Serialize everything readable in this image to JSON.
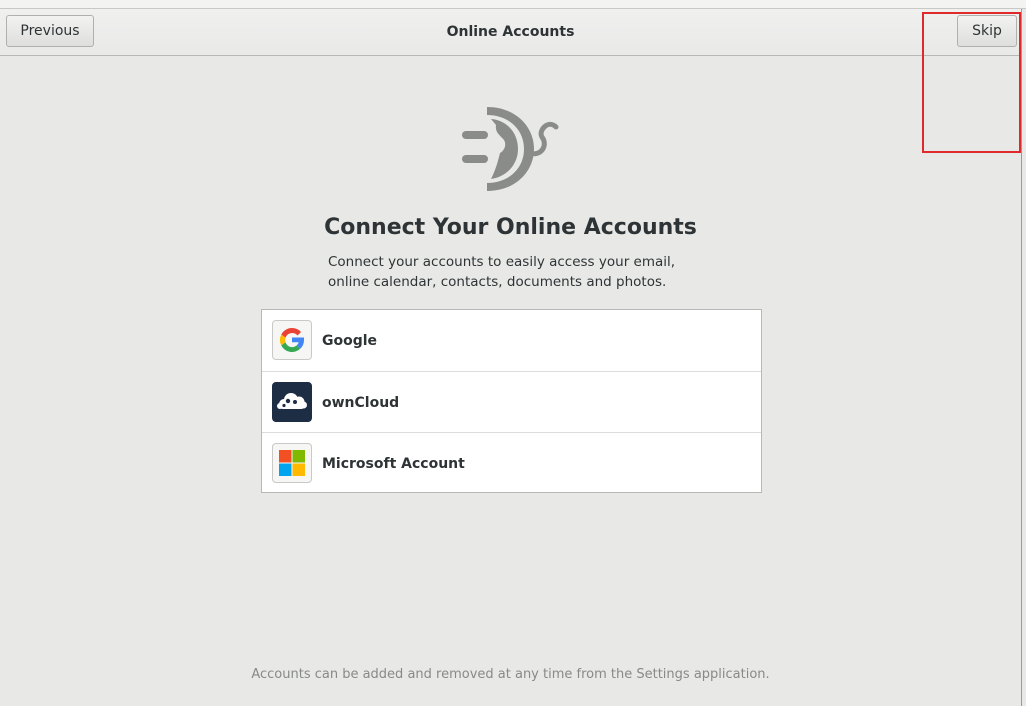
{
  "window": {
    "title": "Online Accounts",
    "previous_label": "Previous",
    "skip_label": "Skip"
  },
  "main": {
    "heading": "Connect Your Online Accounts",
    "description_line1": "Connect your accounts to easily access your email,",
    "description_line2": "online calendar, contacts, documents and photos.",
    "accounts": [
      {
        "label": "Google",
        "icon": "google-icon"
      },
      {
        "label": "ownCloud",
        "icon": "owncloud-icon"
      },
      {
        "label": "Microsoft Account",
        "icon": "microsoft-icon"
      }
    ],
    "footer": "Accounts can be added and removed at any time from the Settings application."
  },
  "colors": {
    "highlight_box": "#e0292b",
    "google_blue": "#4285f4",
    "google_red": "#ea4335",
    "google_yellow": "#fbbc05",
    "google_green": "#34a853",
    "owncloud_bg": "#1d2d44",
    "ms_red": "#f25022",
    "ms_green": "#7fba00",
    "ms_blue": "#00a4ef",
    "ms_yellow": "#ffb900"
  }
}
